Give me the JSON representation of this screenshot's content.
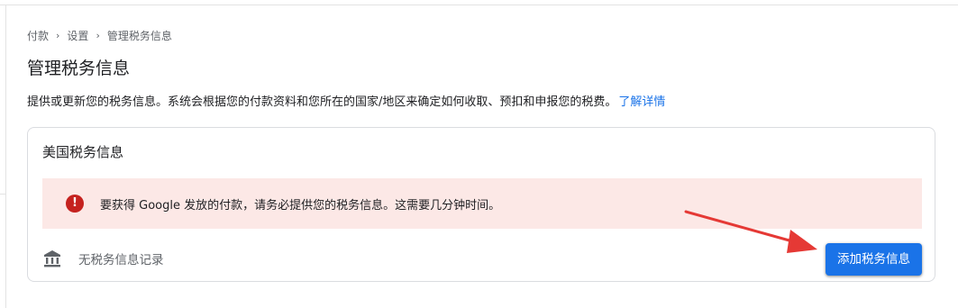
{
  "breadcrumb": {
    "items": [
      "付款",
      "设置",
      "管理税务信息"
    ],
    "separator": "›"
  },
  "page": {
    "title": "管理税务信息",
    "description": "提供或更新您的税务信息。系统会根据您的付款资料和您所在的国家/地区来确定如何收取、预扣和申报您的税费。",
    "learn_more": "了解详情"
  },
  "card": {
    "title": "美国税务信息",
    "alert": {
      "icon": "error-icon",
      "icon_glyph": "!",
      "text": "要获得 Google 发放的付款，请务必提供您的税务信息。这需要几分钟时间。"
    },
    "records": {
      "icon": "bank-icon",
      "text": "无税务信息记录"
    },
    "add_button_label": "添加税务信息"
  },
  "annotation": {
    "arrow_icon": "red-arrow-icon"
  },
  "colors": {
    "accent": "#1a73e8",
    "alert_bg": "#fce8e6",
    "error": "#c5221f",
    "annotation": "#e53935"
  }
}
